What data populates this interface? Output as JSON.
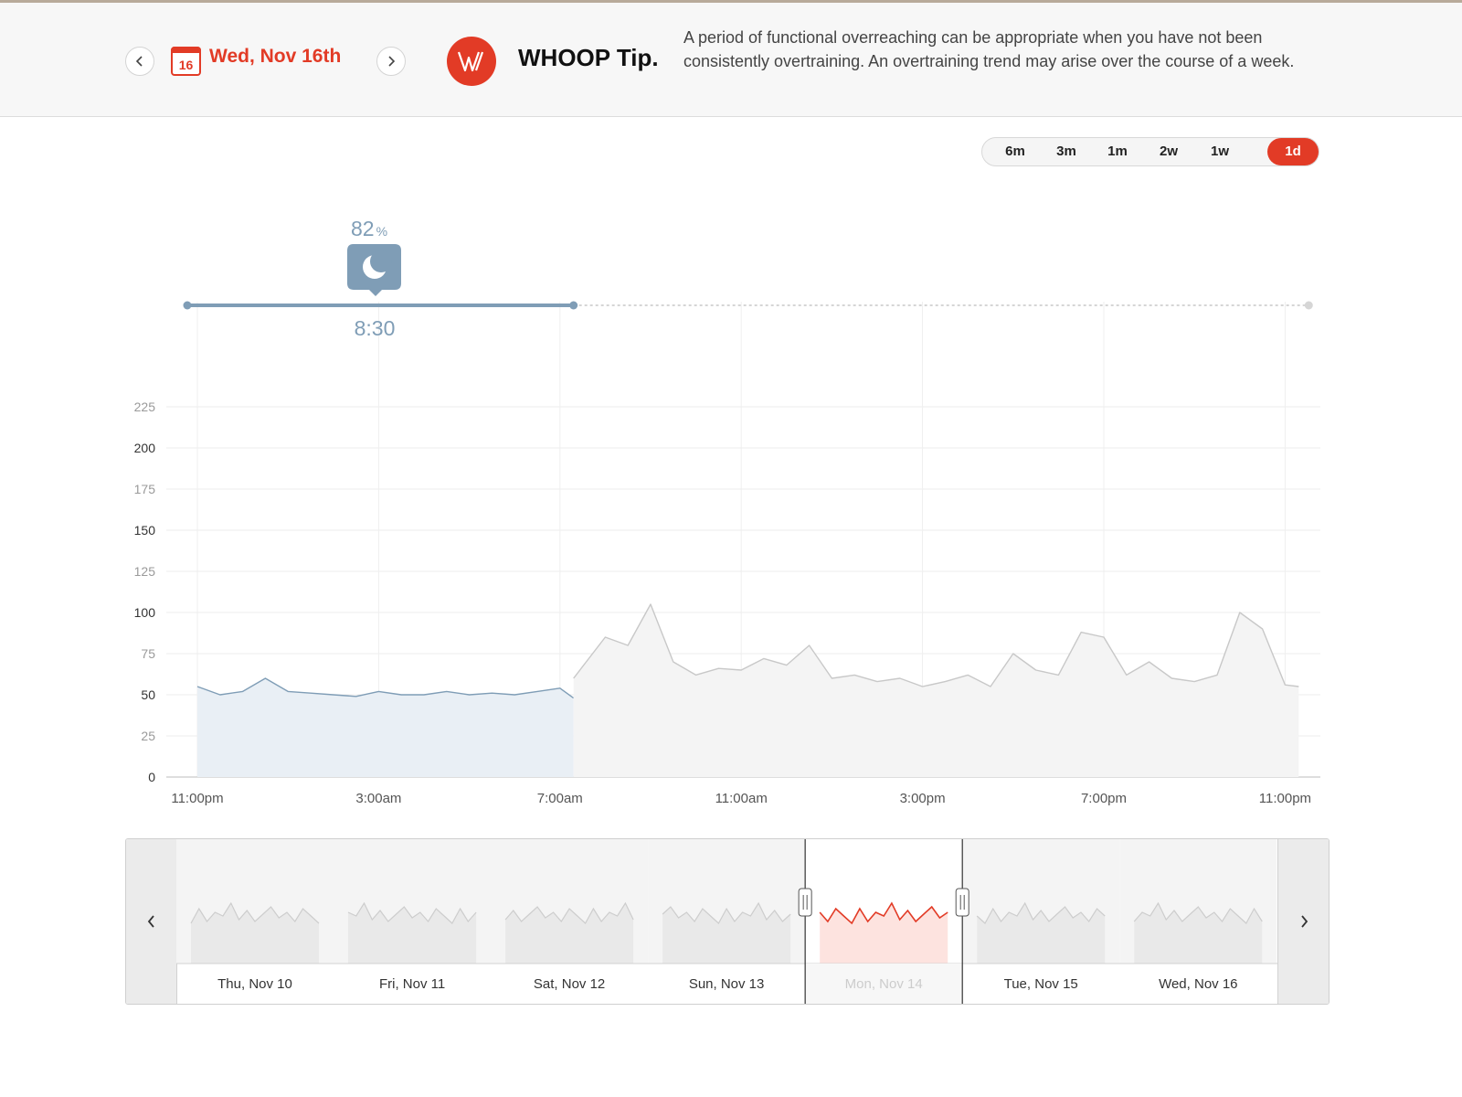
{
  "header": {
    "prev_label": "previous day",
    "calendar_day": "16",
    "date": "Wed, Nov 16th",
    "tip_title": "WHOOP Tip.",
    "tip_text": "A period of functional overreaching can be appropriate when you have not been consistently overtraining. An overtraining trend may arise over the course of a week."
  },
  "ranges": [
    {
      "label": "6m",
      "active": false
    },
    {
      "label": "3m",
      "active": false
    },
    {
      "label": "1m",
      "active": false
    },
    {
      "label": "2w",
      "active": false
    },
    {
      "label": "1w",
      "active": false
    },
    {
      "label": "1d",
      "active": true
    }
  ],
  "sleep": {
    "performance": "82",
    "performance_unit": "%",
    "duration": "8:30",
    "icon": "moon-icon"
  },
  "colors": {
    "accent": "#e23b26",
    "sleep": "#7f9db6",
    "sleep_fill": "#e9eff5",
    "awake": "#c8c8c8",
    "awake_fill": "#f4f4f4"
  },
  "chart_data": {
    "type": "line",
    "title": "",
    "xlabel": "",
    "ylabel": "",
    "ylim": [
      0,
      225
    ],
    "y_ticks": [
      "0",
      "25",
      "50",
      "75",
      "100",
      "125",
      "150",
      "175",
      "200",
      "225"
    ],
    "x_ticks": [
      "11:00pm",
      "3:00am",
      "7:00am",
      "11:00am",
      "3:00pm",
      "7:00pm",
      "11:00pm"
    ],
    "grid": true,
    "series": [
      {
        "segment": "sleep",
        "x_hours": [
          0,
          0.5,
          1,
          1.5,
          2,
          2.5,
          3,
          3.5,
          4,
          4.5,
          5,
          5.5,
          6,
          6.5,
          7,
          7.5,
          8,
          8.3
        ],
        "values": [
          55,
          50,
          52,
          60,
          52,
          51,
          50,
          49,
          52,
          50,
          50,
          52,
          50,
          51,
          50,
          52,
          54,
          48
        ]
      },
      {
        "segment": "awake",
        "x_hours": [
          8.3,
          9,
          9.5,
          10,
          10.5,
          11,
          11.5,
          12,
          12.5,
          13,
          13.5,
          14,
          14.5,
          15,
          15.5,
          16,
          16.5,
          17,
          17.5,
          18,
          18.5,
          19,
          19.5,
          20,
          20.5,
          21,
          21.5,
          22,
          22.5,
          23,
          23.5,
          24,
          24.3
        ],
        "values": [
          60,
          85,
          80,
          105,
          70,
          62,
          66,
          65,
          72,
          68,
          80,
          60,
          62,
          58,
          60,
          55,
          58,
          62,
          55,
          75,
          65,
          62,
          88,
          85,
          62,
          70,
          60,
          58,
          62,
          100,
          90,
          56,
          55
        ]
      }
    ]
  },
  "navigator": {
    "days": [
      {
        "label": "Thu, Nov 10",
        "selected": false
      },
      {
        "label": "Fri, Nov 11",
        "selected": false
      },
      {
        "label": "Sat, Nov 12",
        "selected": false
      },
      {
        "label": "Sun, Nov 13",
        "selected": false
      },
      {
        "label": "Mon, Nov 14",
        "selected": true
      },
      {
        "label": "Tue, Nov 15",
        "selected": false
      },
      {
        "label": "Wed, Nov 16",
        "selected": false
      }
    ]
  }
}
